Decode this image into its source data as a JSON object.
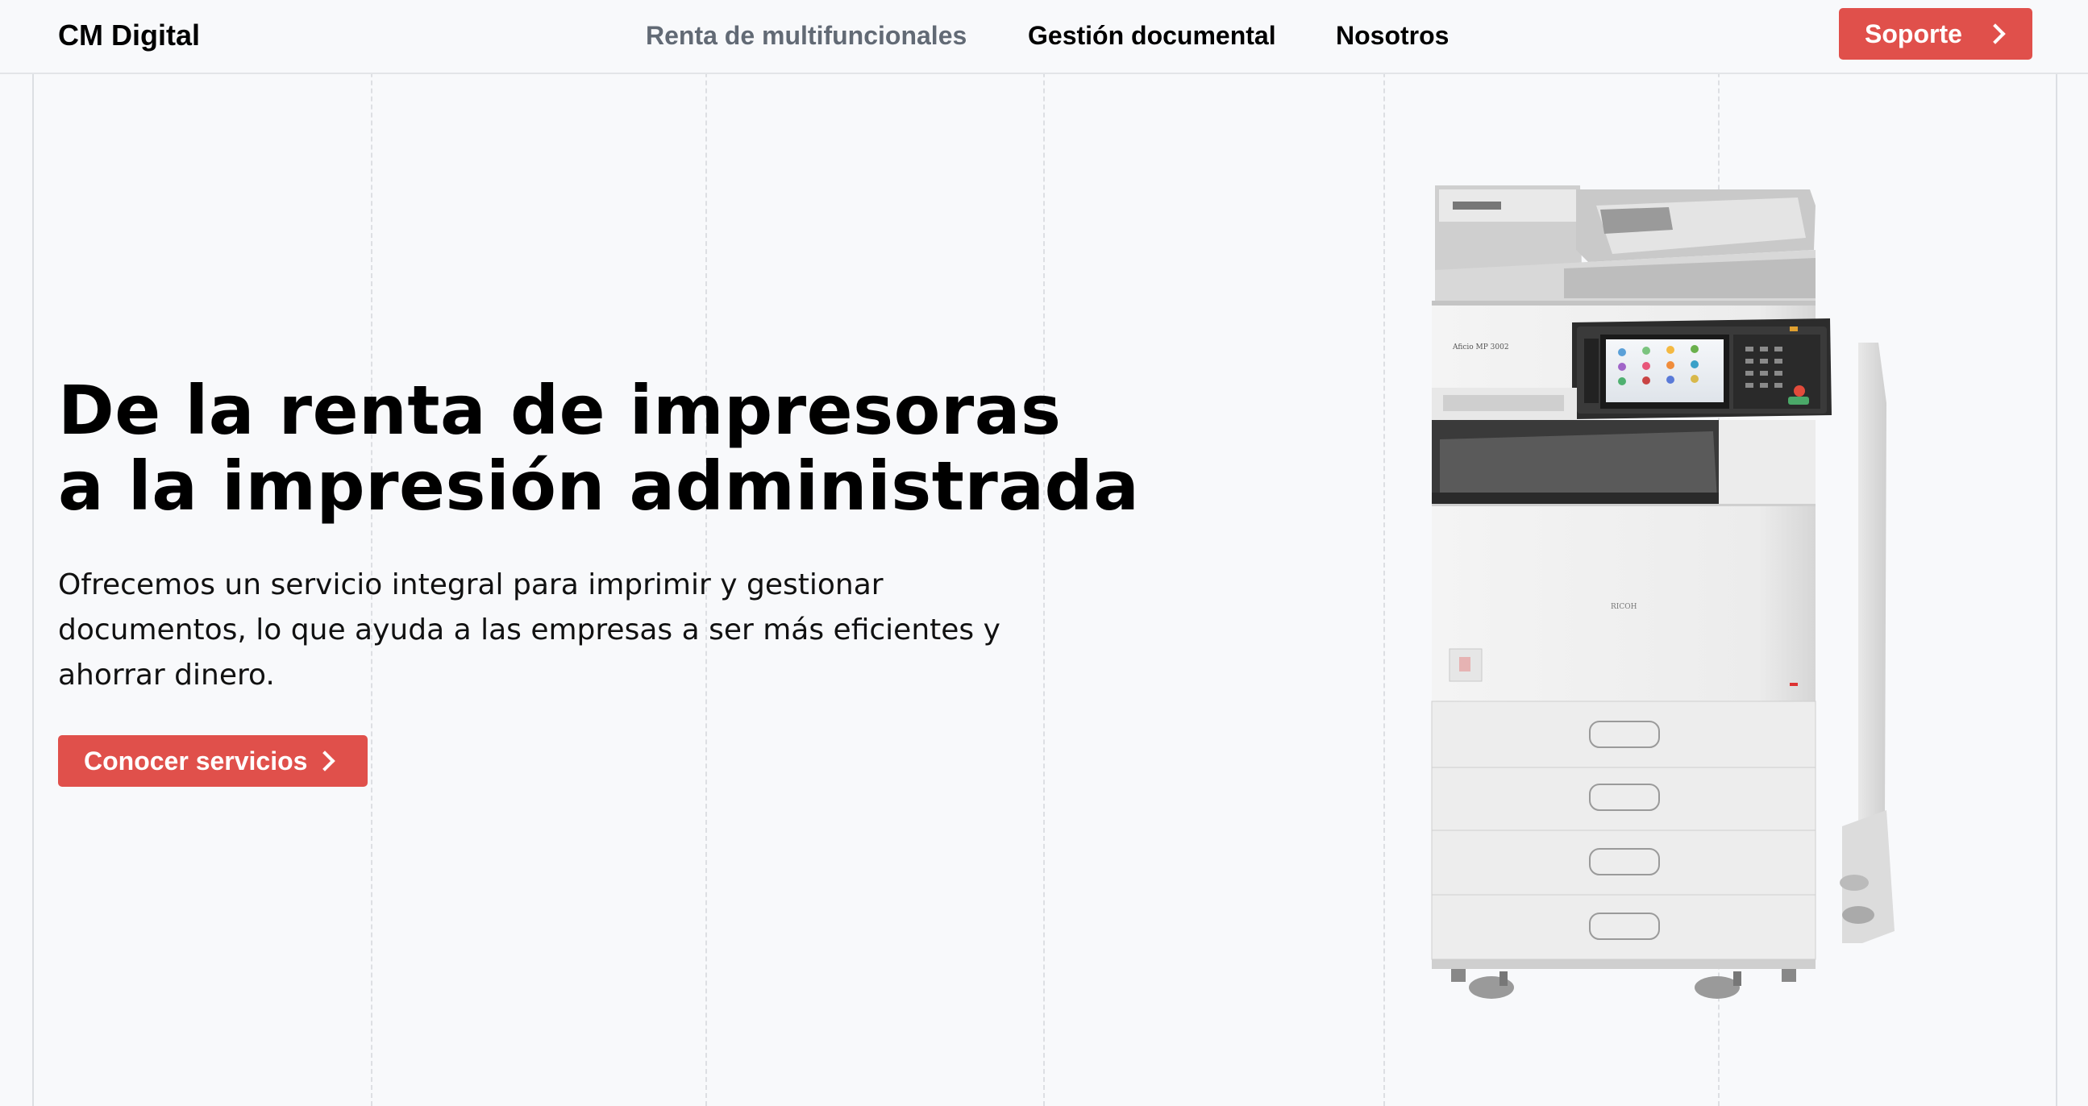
{
  "header": {
    "logo": "CM Digital",
    "nav": [
      {
        "label": "Renta de multifuncionales"
      },
      {
        "label": "Gestión documental"
      },
      {
        "label": "Nosotros"
      }
    ],
    "support_label": "Soporte"
  },
  "hero": {
    "title_line1": "De la renta de impresoras",
    "title_line2": "a la impresión administrada",
    "description": "Ofrecemos un servicio integral para imprimir y gestionar documentos, lo que ayuda a las empresas a ser más eficientes y ahorrar dinero.",
    "cta_label": "Conocer servicios"
  },
  "colors": {
    "accent": "#e0504b",
    "background": "#f8f9fb",
    "nav_muted": "#626a75"
  },
  "icons": {
    "button_chevron": "chevron-right-icon",
    "product": "multifunction-printer"
  }
}
